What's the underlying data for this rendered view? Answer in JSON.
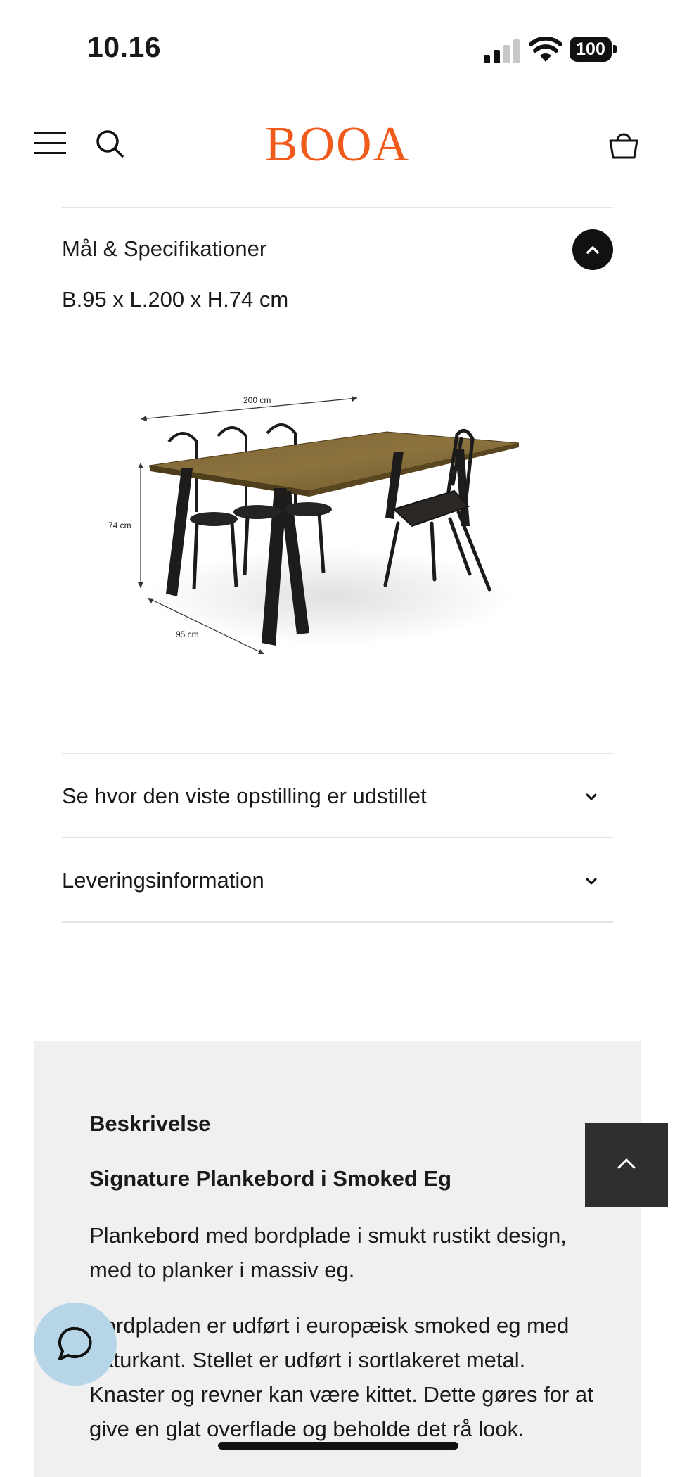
{
  "status_bar": {
    "time": "10.16",
    "battery": "100"
  },
  "header": {
    "logo": "BOOA"
  },
  "accordion_open": {
    "title": "Mål & Specifikationer",
    "dimensions": "B.95 x L.200 x H.74 cm",
    "image_labels": {
      "length": "200 cm",
      "height": "74 cm",
      "depth": "95 cm"
    }
  },
  "accordion_items": [
    {
      "title": "Se hvor den viste opstilling er udstillet"
    },
    {
      "title": "Leveringsinformation"
    }
  ],
  "description": {
    "heading": "Beskrivelse",
    "subheading": "Signature Plankebord i Smoked Eg",
    "paragraph_1": "Plankebord med bordplade i smukt rustikt design, med to planker i massiv eg.",
    "paragraph_2": "Bordpladen er udført i europæisk smoked eg med naturkant. Stellet er udført i sortlakeret metal. Knaster og revner kan være kittet. Dette gøres for at give en glat overflade og beholde det rå look."
  },
  "colors": {
    "brand": "#f05a1a",
    "card_bg": "#f1f0f0",
    "chat_bg": "#b6d5e6",
    "scroll_top_bg": "#2f2f2f"
  }
}
